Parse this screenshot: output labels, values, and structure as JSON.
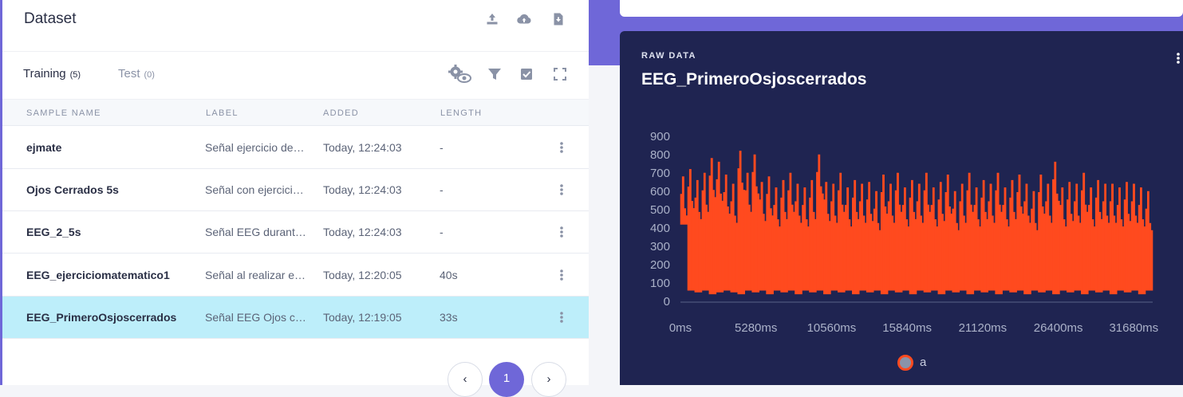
{
  "dataset": {
    "title": "Dataset",
    "header_icons": [
      "upload-icon",
      "cloud-upload-icon",
      "download-file-icon"
    ],
    "tabs": [
      {
        "label": "Training",
        "count": "(5)"
      },
      {
        "label": "Test",
        "count": "(0)"
      }
    ],
    "toolbar_icons": [
      "settings-eye-icon",
      "filter-icon",
      "check-square-icon",
      "fullscreen-icon"
    ],
    "columns": [
      "SAMPLE NAME",
      "LABEL",
      "ADDED",
      "LENGTH"
    ],
    "rows": [
      {
        "name": "ejmate",
        "label": "Señal ejercicio de…",
        "added": "Today, 12:24:03",
        "length": "-",
        "selected": false
      },
      {
        "name": "Ojos Cerrados 5s",
        "label": "Señal con ejercici…",
        "added": "Today, 12:24:03",
        "length": "-",
        "selected": false
      },
      {
        "name": "EEG_2_5s",
        "label": "Señal EEG durant…",
        "added": "Today, 12:24:03",
        "length": "-",
        "selected": false
      },
      {
        "name": "EEG_ejerciciomatematico1",
        "label": "Señal al realizar e…",
        "added": "Today, 12:20:05",
        "length": "40s",
        "selected": false
      },
      {
        "name": "EEG_PrimeroOsjoscerrados",
        "label": "Señal EEG Ojos ce…",
        "added": "Today, 12:19:05",
        "length": "33s",
        "selected": true
      }
    ],
    "pagination": {
      "prev": "‹",
      "page": "1",
      "next": "›"
    }
  },
  "raw_data": {
    "kicker": "RAW DATA",
    "title": "EEG_PrimeroOsjoscerrados"
  },
  "colors": {
    "accent": "#6f67d8",
    "selected_row": "#bdeefa",
    "chart_bg": "#1f2451",
    "signal": "#ff4a1f"
  },
  "chart_data": {
    "type": "area",
    "title": "",
    "xlabel": "",
    "ylabel": "",
    "ylim": [
      0,
      900
    ],
    "xlim": [
      0,
      33000
    ],
    "y_ticks": [
      0,
      100,
      200,
      300,
      400,
      500,
      600,
      700,
      800,
      900
    ],
    "x_ticks": [
      0,
      5280,
      10560,
      15840,
      21120,
      26400,
      31680
    ],
    "x_tick_labels": [
      "0ms",
      "5280ms",
      "10560ms",
      "15840ms",
      "21120ms",
      "26400ms",
      "31680ms"
    ],
    "y_tick_labels": [
      "0",
      "100",
      "200",
      "300",
      "400",
      "500",
      "600",
      "700",
      "800",
      "900"
    ],
    "grid": false,
    "legend": "bottom-center",
    "series": [
      {
        "name": "a",
        "color": "#ff4a1f",
        "x": [
          0,
          500,
          1000,
          1500,
          2000,
          2500,
          3000,
          3500,
          4000,
          4500,
          5000,
          5500,
          6000,
          6500,
          7000,
          7500,
          8000,
          8500,
          9000,
          9500,
          10000,
          10500,
          11000,
          11500,
          12000,
          12500,
          13000,
          13500,
          14000,
          14500,
          15000,
          15500,
          16000,
          16500,
          17000,
          17500,
          18000,
          18500,
          19000,
          19500,
          20000,
          20500,
          21000,
          21500,
          22000,
          22500,
          23000,
          23500,
          24000,
          24500,
          25000,
          25500,
          26000,
          26500,
          27000,
          27500,
          28000,
          28500,
          29000,
          29500,
          30000,
          30500,
          31000,
          31500,
          32000,
          32500
        ],
        "y": [
          680,
          720,
          660,
          700,
          780,
          760,
          690,
          640,
          820,
          700,
          800,
          650,
          680,
          620,
          660,
          700,
          640,
          620,
          660,
          800,
          650,
          640,
          700,
          620,
          660,
          640,
          650,
          600,
          690,
          640,
          700,
          620,
          660,
          640,
          700,
          620,
          650,
          690,
          600,
          640,
          700,
          620,
          660,
          640,
          700,
          620,
          660,
          690,
          640,
          600,
          690,
          640,
          760,
          620,
          650,
          640,
          700,
          620,
          660,
          640,
          640,
          620,
          650,
          640,
          620,
          600
        ],
        "y_min": [
          420,
          60,
          50,
          60,
          40,
          50,
          60,
          50,
          40,
          60,
          50,
          60,
          40,
          60,
          50,
          60,
          40,
          60,
          50,
          60,
          40,
          60,
          50,
          60,
          40,
          60,
          50,
          60,
          40,
          60,
          50,
          60,
          40,
          60,
          50,
          60,
          40,
          60,
          50,
          60,
          40,
          60,
          50,
          60,
          40,
          60,
          50,
          60,
          40,
          60,
          50,
          60,
          40,
          60,
          50,
          60,
          40,
          60,
          50,
          60,
          40,
          60,
          50,
          60,
          40,
          60
        ]
      }
    ]
  }
}
